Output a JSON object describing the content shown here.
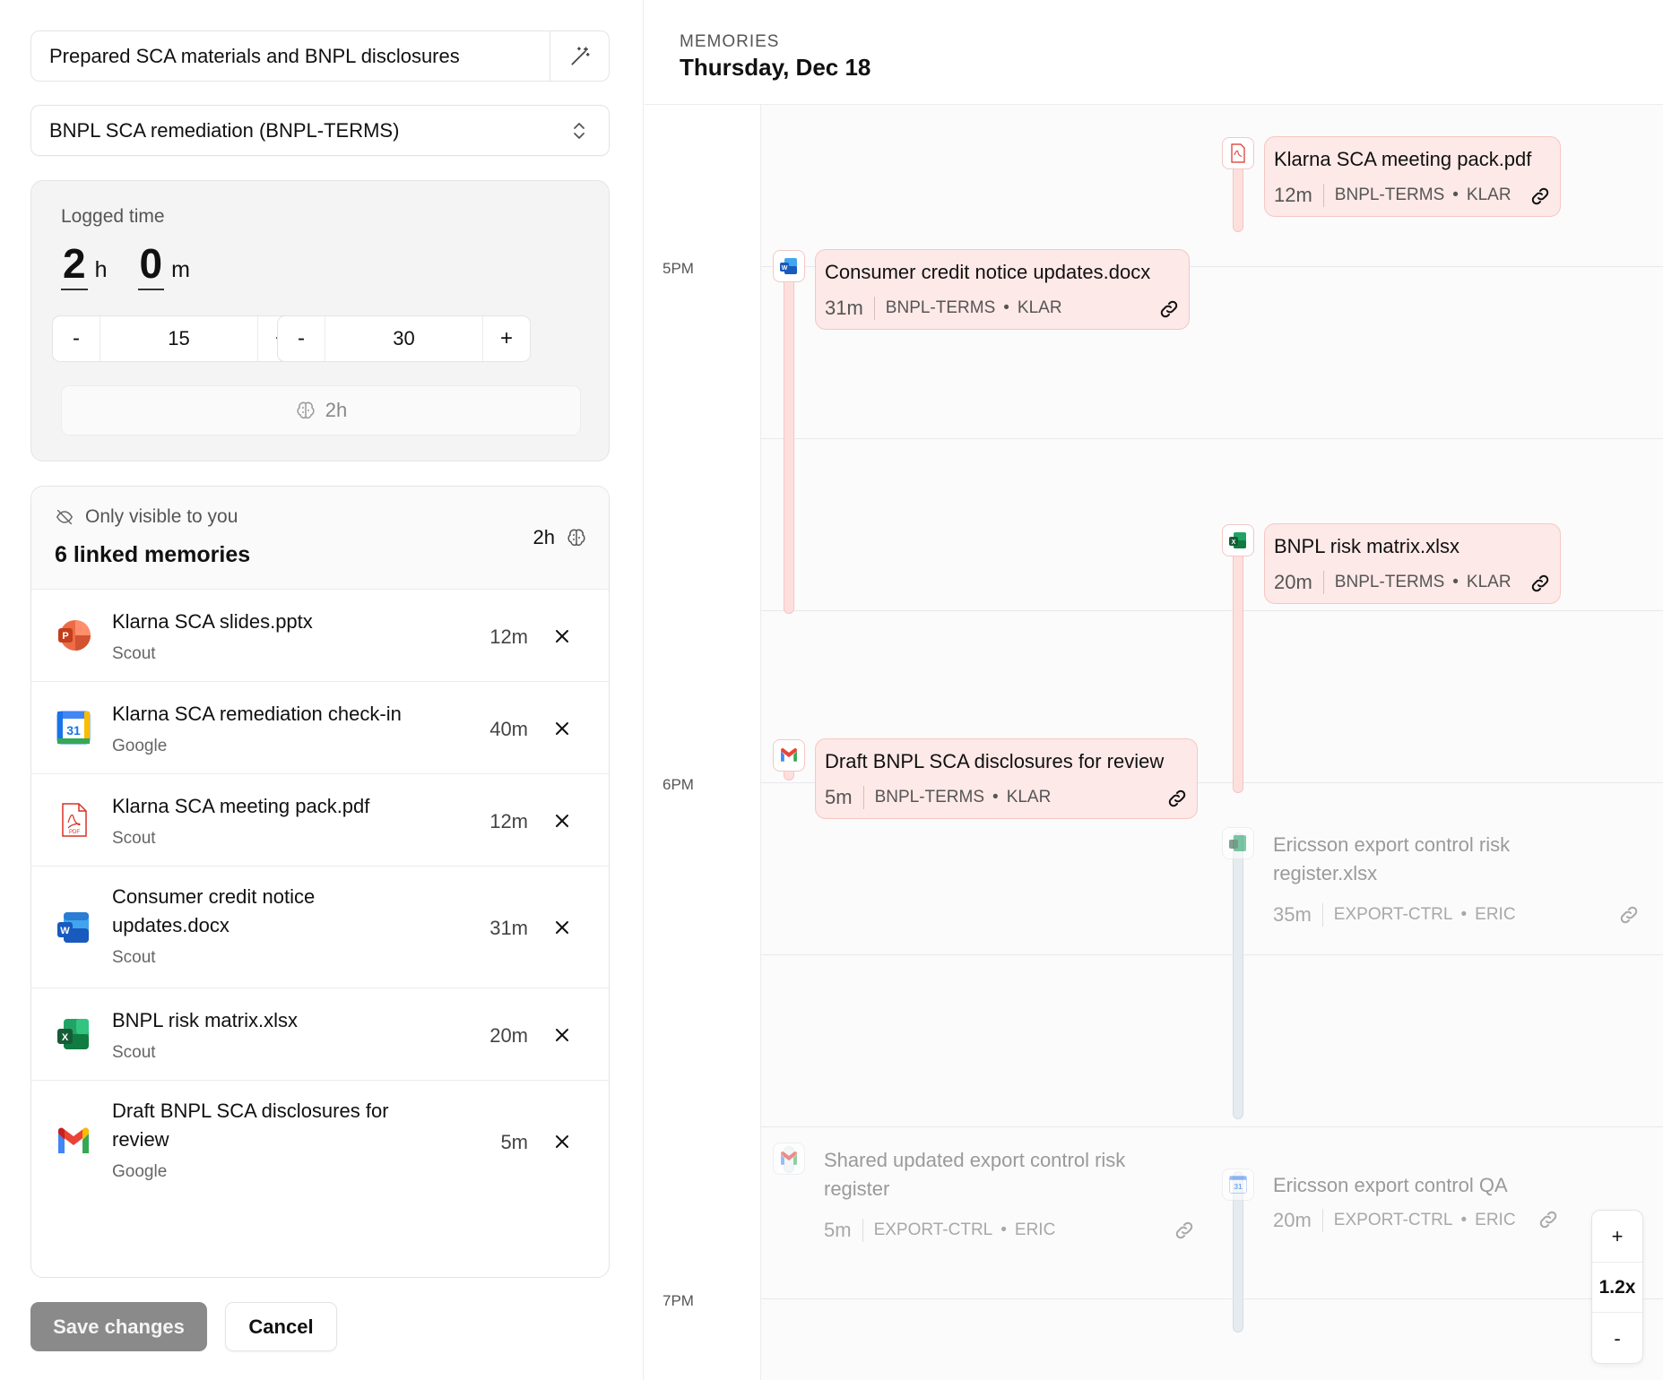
{
  "editor": {
    "description": "Prepared SCA materials and BNPL disclosures",
    "project": "BNPL SCA remediation (BNPL-TERMS)",
    "logged_time": {
      "label": "Logged time",
      "hours": "2",
      "hours_unit": "h",
      "minutes": "0",
      "minutes_unit": "m"
    },
    "steppers": [
      {
        "minus": "-",
        "value": "15",
        "plus": "+"
      },
      {
        "minus": "-",
        "value": "30",
        "plus": "+"
      }
    ],
    "ai_suggestion": "2h"
  },
  "linked": {
    "visibility": "Only visible to you",
    "count_label": "6 linked memories",
    "total": "2h",
    "items": [
      {
        "title": "Klarna SCA slides.pptx",
        "source": "Scout",
        "duration": "12m",
        "icon": "powerpoint-icon"
      },
      {
        "title": "Klarna SCA remediation check-in",
        "source": "Google",
        "duration": "40m",
        "icon": "google-calendar-icon"
      },
      {
        "title": "Klarna SCA meeting pack.pdf",
        "source": "Scout",
        "duration": "12m",
        "icon": "pdf-icon"
      },
      {
        "title": "Consumer credit notice updates.docx",
        "source": "Scout",
        "duration": "31m",
        "icon": "word-icon"
      },
      {
        "title": "BNPL risk matrix.xlsx",
        "source": "Scout",
        "duration": "20m",
        "icon": "excel-icon"
      },
      {
        "title": "Draft BNPL SCA disclosures for review",
        "source": "Google",
        "duration": "5m",
        "icon": "gmail-icon"
      }
    ]
  },
  "actions": {
    "save": "Save changes",
    "cancel": "Cancel"
  },
  "timeline": {
    "caption": "MEMORIES",
    "date": "Thursday, Dec 18",
    "hours": [
      "5PM",
      "6PM",
      "7PM"
    ],
    "events": [
      {
        "title": "Klarna SCA meeting pack.pdf",
        "duration": "12m",
        "project": "BNPL-TERMS",
        "client": "KLAR",
        "icon": "pdf-icon",
        "linked": true
      },
      {
        "title": "Consumer credit notice updates.docx",
        "duration": "31m",
        "project": "BNPL-TERMS",
        "client": "KLAR",
        "icon": "word-icon",
        "linked": true
      },
      {
        "title": "BNPL risk matrix.xlsx",
        "duration": "20m",
        "project": "BNPL-TERMS",
        "client": "KLAR",
        "icon": "excel-icon",
        "linked": true
      },
      {
        "title": "Draft BNPL SCA disclosures for review",
        "duration": "5m",
        "project": "BNPL-TERMS",
        "client": "KLAR",
        "icon": "gmail-icon",
        "linked": true
      },
      {
        "title": "Ericsson export control risk register.xlsx",
        "duration": "35m",
        "project": "EXPORT-CTRL",
        "client": "ERIC",
        "icon": "excel-icon",
        "linked": false
      },
      {
        "title": "Shared updated export control risk register",
        "duration": "5m",
        "project": "EXPORT-CTRL",
        "client": "ERIC",
        "icon": "gmail-icon",
        "linked": false
      },
      {
        "title": "Ericsson export control QA",
        "duration": "20m",
        "project": "EXPORT-CTRL",
        "client": "ERIC",
        "icon": "google-calendar-icon",
        "linked": false
      }
    ],
    "zoom": {
      "plus": "+",
      "level": "1.2x",
      "minus": "-"
    }
  },
  "colors": {
    "linked_bg": "#fde9e7",
    "linked_border": "#f6c7c2",
    "save_bg": "#8a8a8a"
  }
}
